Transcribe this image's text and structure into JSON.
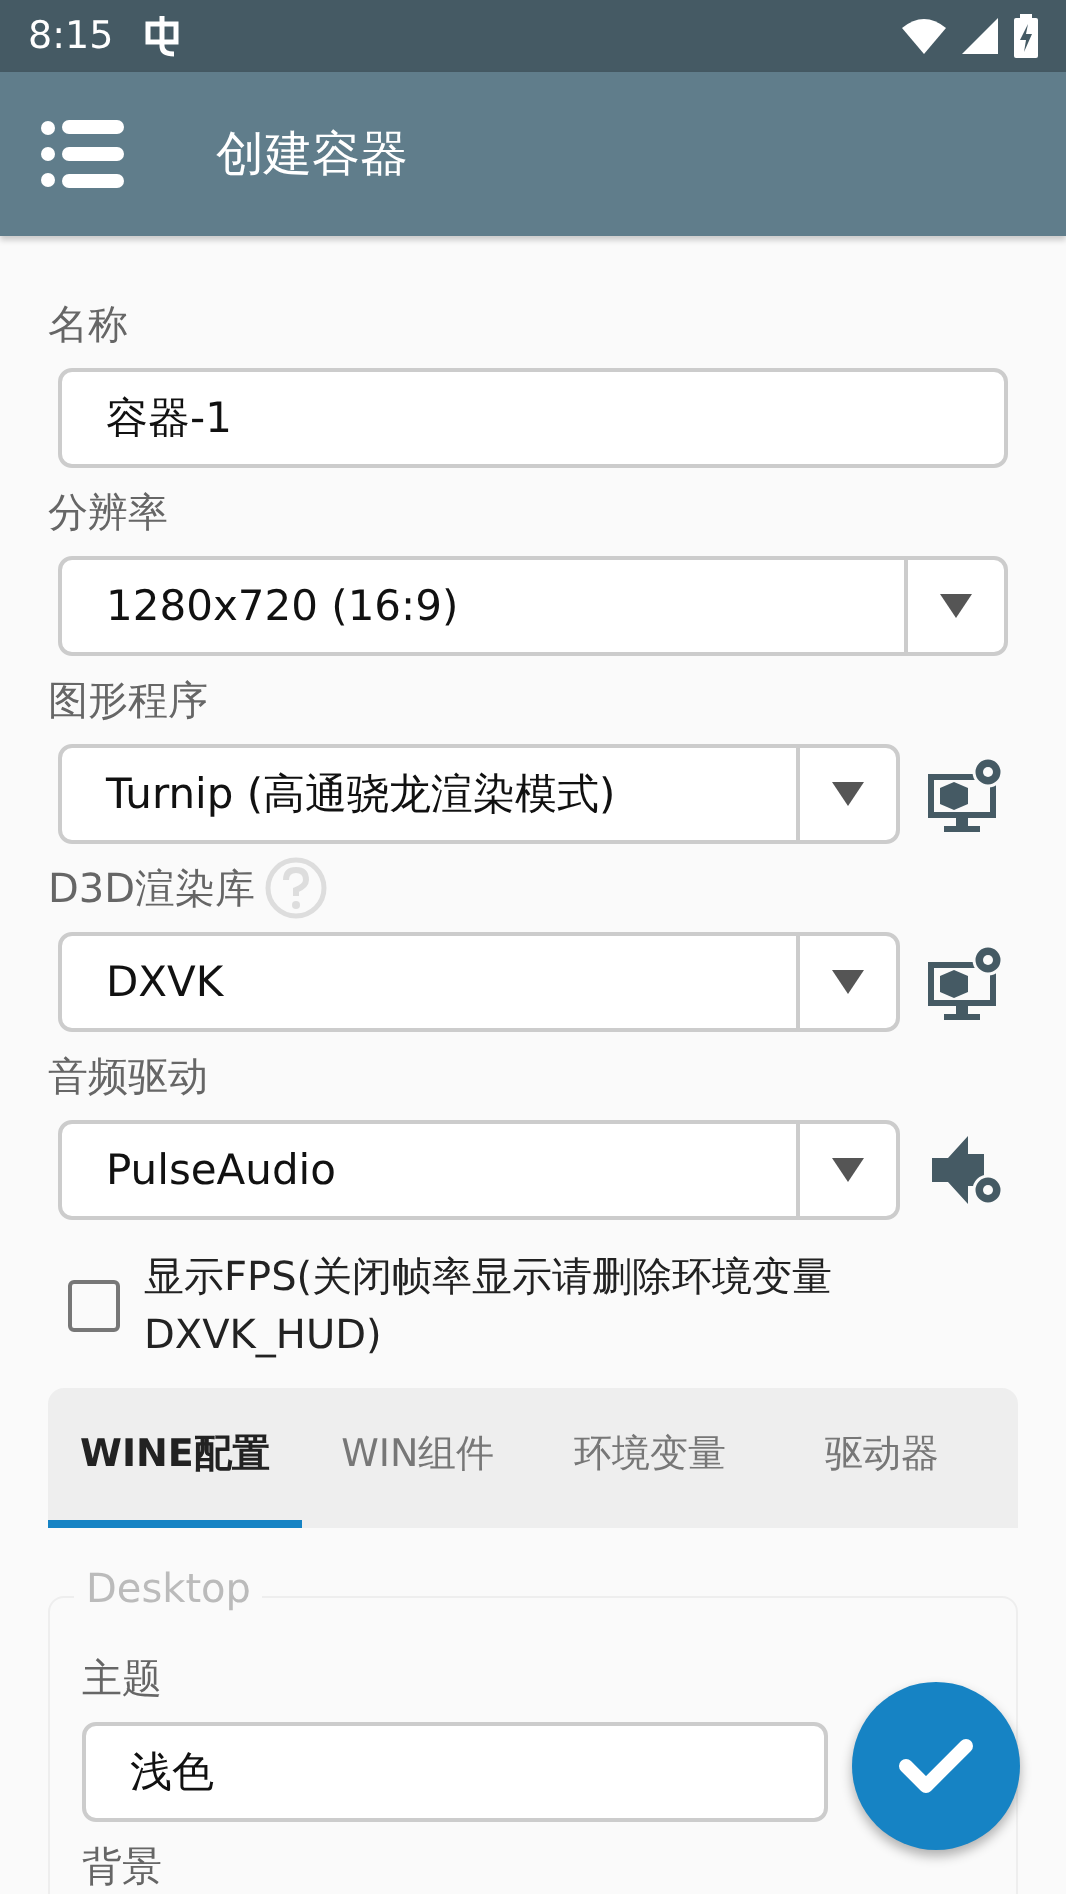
{
  "status_bar": {
    "time": "8:15"
  },
  "app_bar": {
    "title": "创建容器"
  },
  "fields": [
    {
      "label": "名称",
      "kind": "text",
      "value": "容器-1"
    },
    {
      "label": "分辨率",
      "kind": "select",
      "value": "1280x720 (16:9)"
    },
    {
      "label": "图形程序",
      "kind": "select",
      "value": "Turnip (高通骁龙渲染模式)",
      "side_button": {
        "kind": "display"
      }
    },
    {
      "label": "D3D渲染库",
      "kind": "select",
      "help": true,
      "value": "DXVK",
      "side_button": {
        "kind": "display"
      }
    },
    {
      "label": "音频驱动",
      "kind": "select",
      "value": "PulseAudio",
      "side_button": {
        "kind": "audio"
      }
    }
  ],
  "fps_checkbox": {
    "label": "显示FPS(关闭帧率显示请删除环境变量DXVK_HUD)",
    "checked": false
  },
  "tabs": [
    {
      "label": "WINE配置",
      "selected": true
    },
    {
      "label": "WIN组件",
      "selected": false
    },
    {
      "label": "环境变量",
      "selected": false
    },
    {
      "label": "驱动器",
      "selected": false
    }
  ],
  "desktop_group": {
    "legend": "Desktop",
    "fields": [
      {
        "label": "主题",
        "kind": "text",
        "value": "浅色"
      },
      {
        "label": "背景",
        "kind": "label"
      }
    ]
  }
}
